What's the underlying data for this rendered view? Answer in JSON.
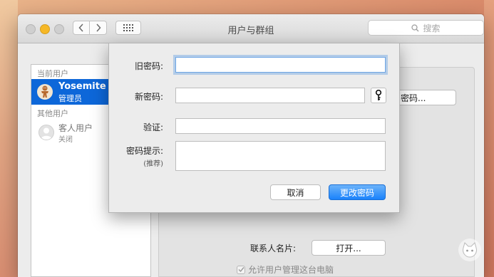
{
  "window": {
    "title": "用户与群组"
  },
  "search": {
    "placeholder": "搜索"
  },
  "userlist": {
    "current_header": "当前用户",
    "current_user": {
      "name": "Yosemite Re",
      "role": "管理员"
    },
    "other_header": "其他用户",
    "guest": {
      "name": "客人用户",
      "status": "关闭"
    }
  },
  "background": {
    "change_password_partial": "密码...",
    "contact_card_label": "联系人名片:",
    "open_button": "打开...",
    "allow_admin_label": "允许用户管理这台电脑"
  },
  "dialog": {
    "old_password_label": "旧密码:",
    "new_password_label": "新密码:",
    "verify_label": "验证:",
    "hint_label": "密码提示:",
    "hint_sublabel": "(推荐)",
    "old_password_value": "",
    "new_password_value": "",
    "verify_value": "",
    "hint_value": "",
    "cancel_label": "取消",
    "confirm_label": "更改密码"
  },
  "icons": {
    "back": "chevron-left-icon",
    "forward": "chevron-right-icon",
    "grid": "grid-icon",
    "search": "search-icon",
    "key": "key-icon"
  },
  "colors": {
    "selection": "#0d67d9",
    "primary_button": "#1a82fb",
    "traffic_yellow": "#f6b826",
    "focus_ring": "#6fa6e4"
  }
}
